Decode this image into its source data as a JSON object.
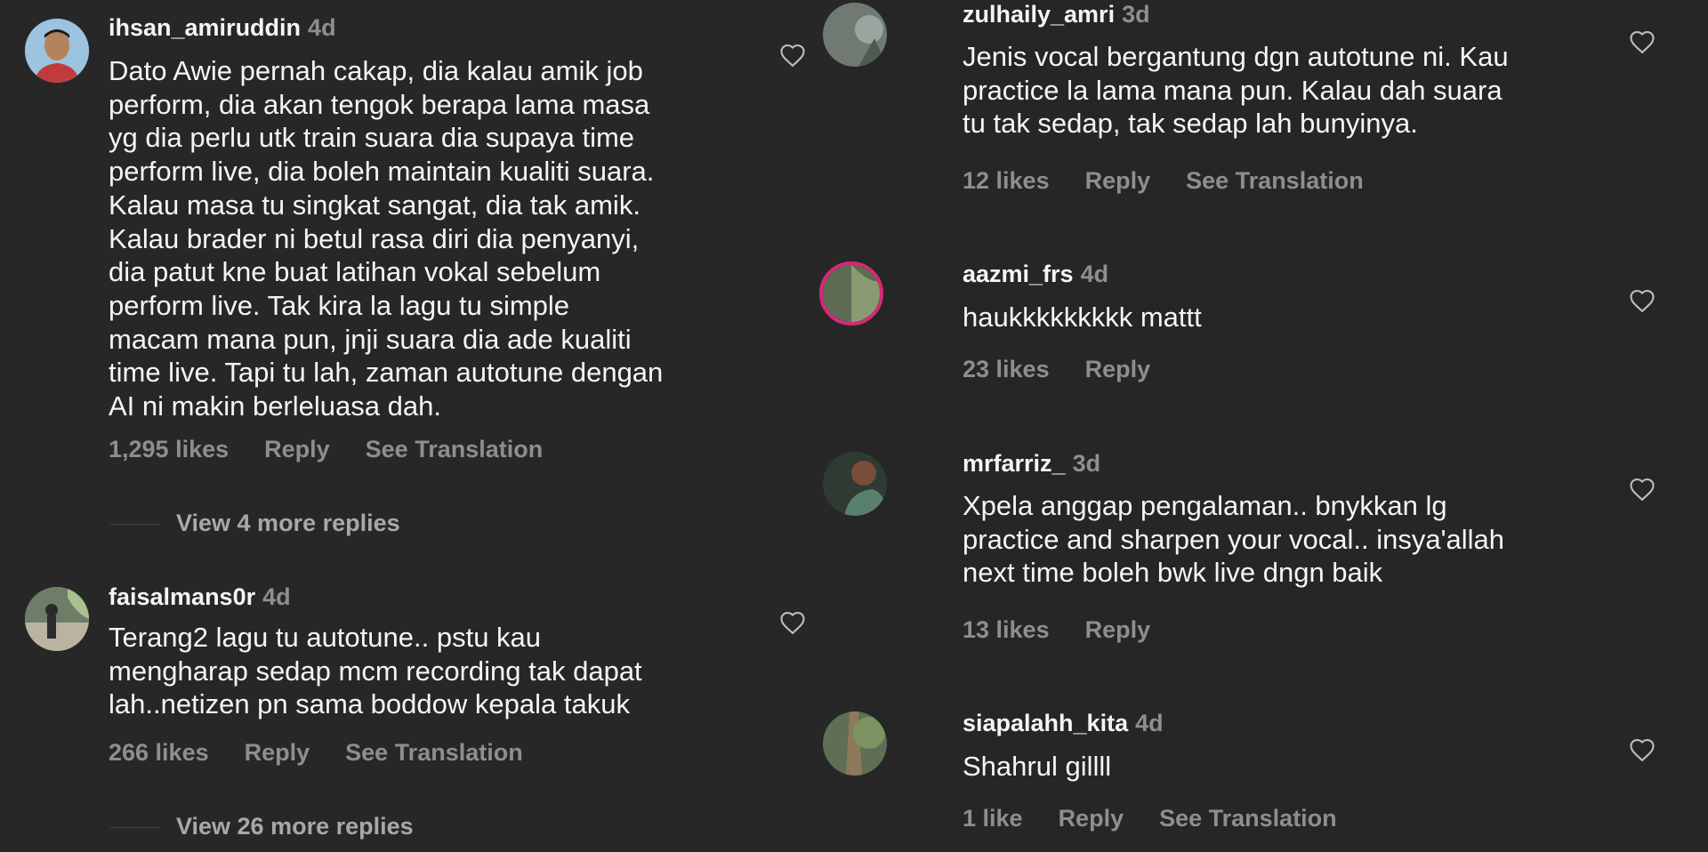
{
  "left": {
    "comments": [
      {
        "username": "ihsan_amiruddin",
        "time": "4d",
        "text": "Dato Awie pernah cakap, dia kalau amik job\nperform, dia akan tengok berapa lama masa\nyg dia perlu utk train suara dia supaya time\nperform live, dia boleh maintain kualiti suara.\nKalau masa tu singkat sangat, dia tak amik.\nKalau brader ni betul rasa diri dia penyanyi,\ndia patut kne buat latihan vokal sebelum\nperform live. Tak kira la lagu tu simple\nmacam mana pun, jnji suara dia ade kualiti\ntime live. Tapi tu lah, zaman autotune dengan\nAI ni makin berleluasa dah.",
        "likes": "1,295 likes",
        "reply": "Reply",
        "translation": "See Translation",
        "more_replies": "View 4 more replies"
      },
      {
        "username": "faisalmans0r",
        "time": "4d",
        "text": "Terang2 lagu tu autotune.. pstu kau\nmengharap sedap mcm recording tak dapat\nlah..netizen pn sama boddow kepala takuk",
        "likes": "266 likes",
        "reply": "Reply",
        "translation": "See Translation",
        "more_replies": "View 26 more replies"
      }
    ]
  },
  "right": {
    "comments": [
      {
        "username": "zulhaily_amri",
        "time": "3d",
        "text": "Jenis vocal bergantung dgn autotune ni. Kau\npractice la lama mana pun. Kalau dah suara\ntu tak sedap, tak sedap lah bunyinya.",
        "likes": "12 likes",
        "reply": "Reply",
        "translation": "See Translation"
      },
      {
        "username": "aazmi_frs",
        "time": "4d",
        "text": "haukkkkkkkkk mattt",
        "likes": "23 likes",
        "reply": "Reply"
      },
      {
        "username": "mrfarriz_",
        "time": "3d",
        "text": "Xpela anggap pengalaman.. bnykkan lg\npractice and sharpen your vocal.. insya'allah\nnext time boleh bwk live dngn baik",
        "likes": "13 likes",
        "reply": "Reply"
      },
      {
        "username": "siapalahh_kita",
        "time": "4d",
        "text": "Shahrul gillll",
        "likes": "1 like",
        "reply": "Reply",
        "translation": "See Translation"
      }
    ]
  },
  "colors": {
    "background": "#262626",
    "text": "#f5f5f5",
    "muted": "#8e8e8e",
    "story_ring": "#d62976"
  }
}
